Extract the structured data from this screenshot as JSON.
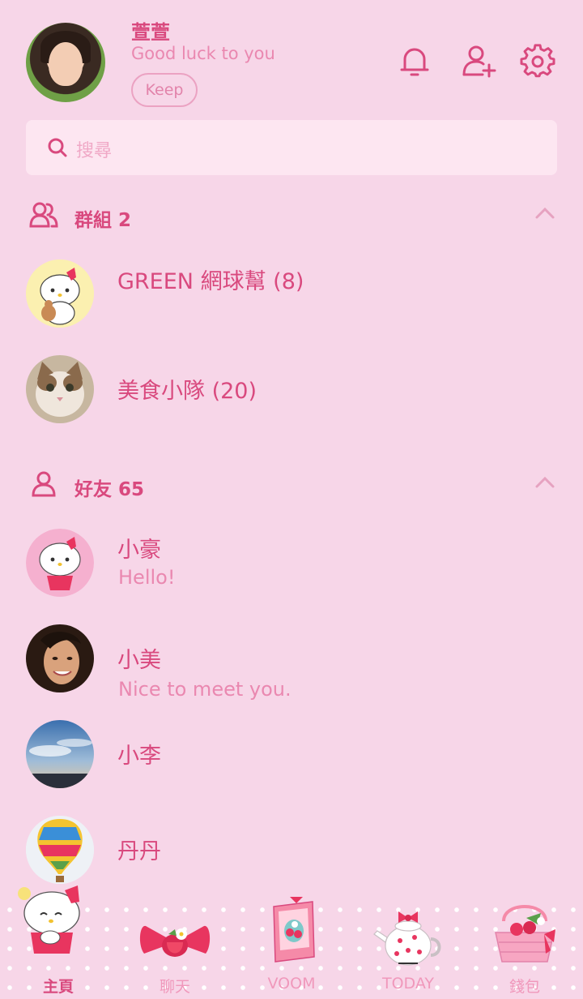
{
  "profile": {
    "name": "萱萱",
    "status": "Good luck to you",
    "keep_label": "Keep"
  },
  "header_icons": [
    "bell-icon",
    "add-friend-icon",
    "settings-gear-icon"
  ],
  "search": {
    "placeholder": "搜尋"
  },
  "groups": {
    "title": "群組 2",
    "items": [
      {
        "name": "GREEN 網球幫 (8)",
        "avatar": "hello-kitty-with-teddy-avatar"
      },
      {
        "name": "美食小隊 (20)",
        "avatar": "cat-avatar"
      }
    ]
  },
  "friends": {
    "title": "好友 65",
    "items": [
      {
        "name": "小豪",
        "status": "Hello!",
        "avatar": "hello-kitty-avatar"
      },
      {
        "name": "小美",
        "status": "Nice to meet you.",
        "avatar": "woman-photo-avatar"
      },
      {
        "name": "小李",
        "status": "",
        "avatar": "sky-photo-avatar"
      },
      {
        "name": "丹丹",
        "status": "",
        "avatar": "hot-air-balloon-avatar"
      }
    ]
  },
  "bottom_nav": {
    "items": [
      {
        "label": "主頁",
        "icon": "hello-kitty-home-icon",
        "active": true
      },
      {
        "label": "聊天",
        "icon": "bow-strawberry-icon",
        "active": false
      },
      {
        "label": "VOOM",
        "icon": "book-icon",
        "active": false
      },
      {
        "label": "TODAY",
        "icon": "teapot-icon",
        "active": false
      },
      {
        "label": "錢包",
        "icon": "strawberry-basket-icon",
        "active": false
      }
    ]
  },
  "colors": {
    "background": "#f7d6e8",
    "accent": "#d9497e",
    "secondary_text": "#ea88b0",
    "search_bg": "#fde6f1"
  }
}
